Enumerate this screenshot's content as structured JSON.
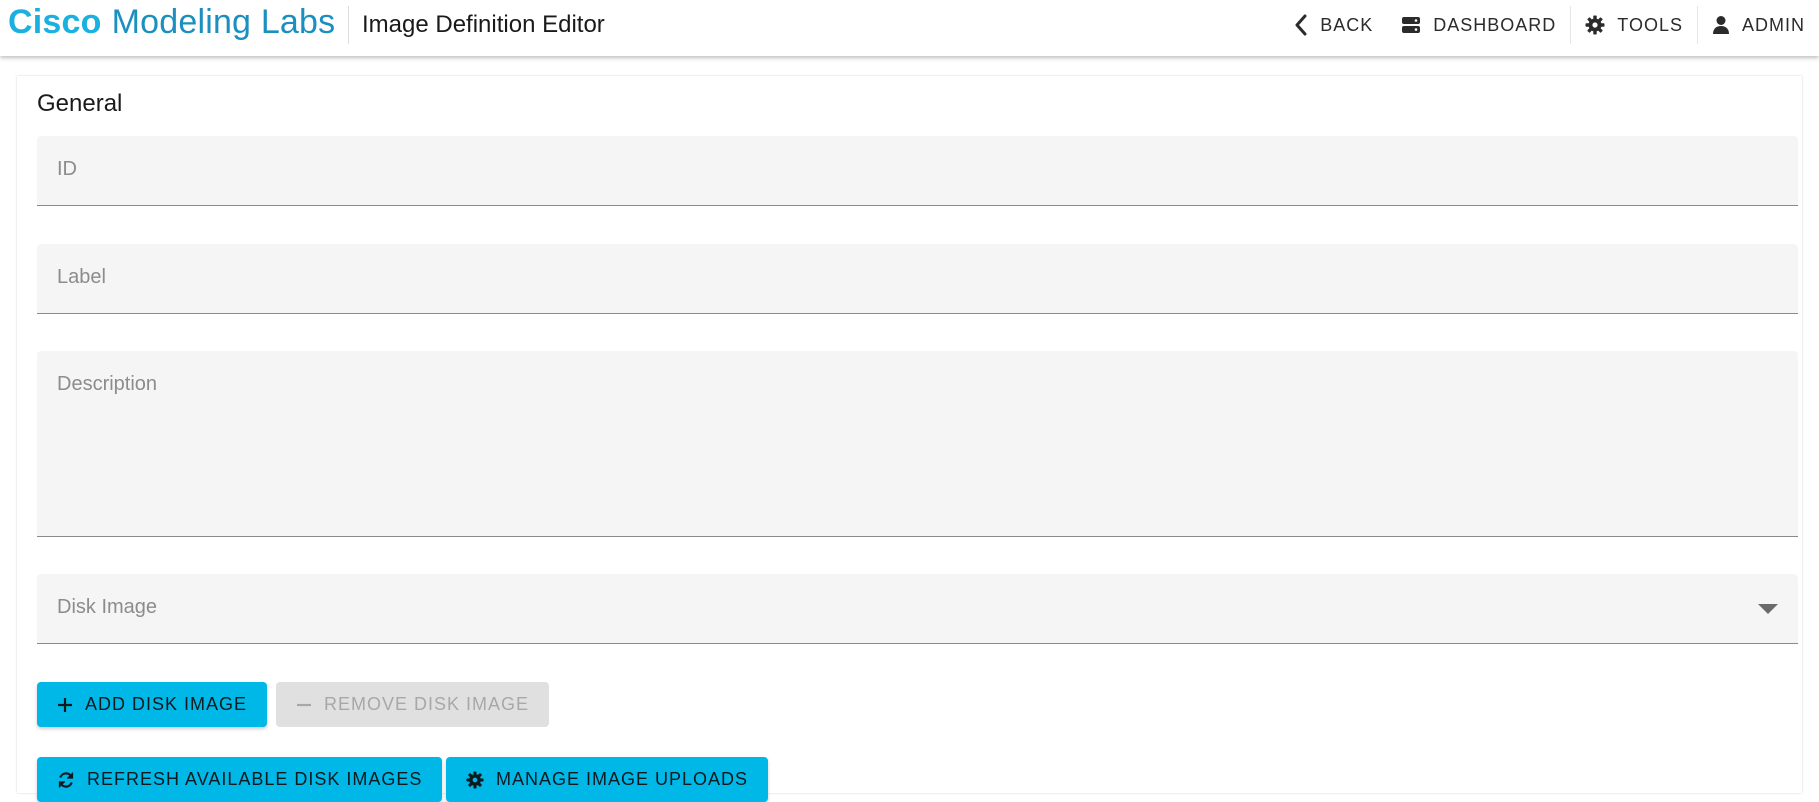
{
  "header": {
    "brand_primary": "Cisco",
    "brand_secondary": "Modeling Labs",
    "page_title": "Image Definition Editor",
    "nav": {
      "back": "BACK",
      "dashboard": "DASHBOARD",
      "tools": "TOOLS",
      "admin": "ADMIN"
    }
  },
  "form": {
    "section_title": "General",
    "id_placeholder": "ID",
    "label_placeholder": "Label",
    "description_placeholder": "Description",
    "disk_image_placeholder": "Disk Image"
  },
  "buttons": {
    "add_disk_image": "ADD DISK IMAGE",
    "remove_disk_image": "REMOVE DISK IMAGE",
    "refresh_disk_images": "REFRESH AVAILABLE DISK IMAGES",
    "manage_image_uploads": "MANAGE IMAGE UPLOADS"
  },
  "icons": {
    "back": "chevron-left-icon",
    "dashboard": "server-icon",
    "tools": "gear-icon",
    "admin": "user-icon",
    "add": "plus-icon",
    "remove": "minus-icon",
    "refresh": "refresh-icon",
    "manage": "gear-icon",
    "dropdown": "caret-down-icon"
  },
  "colors": {
    "brand_primary": "#1ab0e0",
    "brand_secondary": "#1a8fc0",
    "accent_button": "#00b8e8",
    "disabled_button": "#e0e0e0",
    "field_background": "#f5f5f5"
  }
}
